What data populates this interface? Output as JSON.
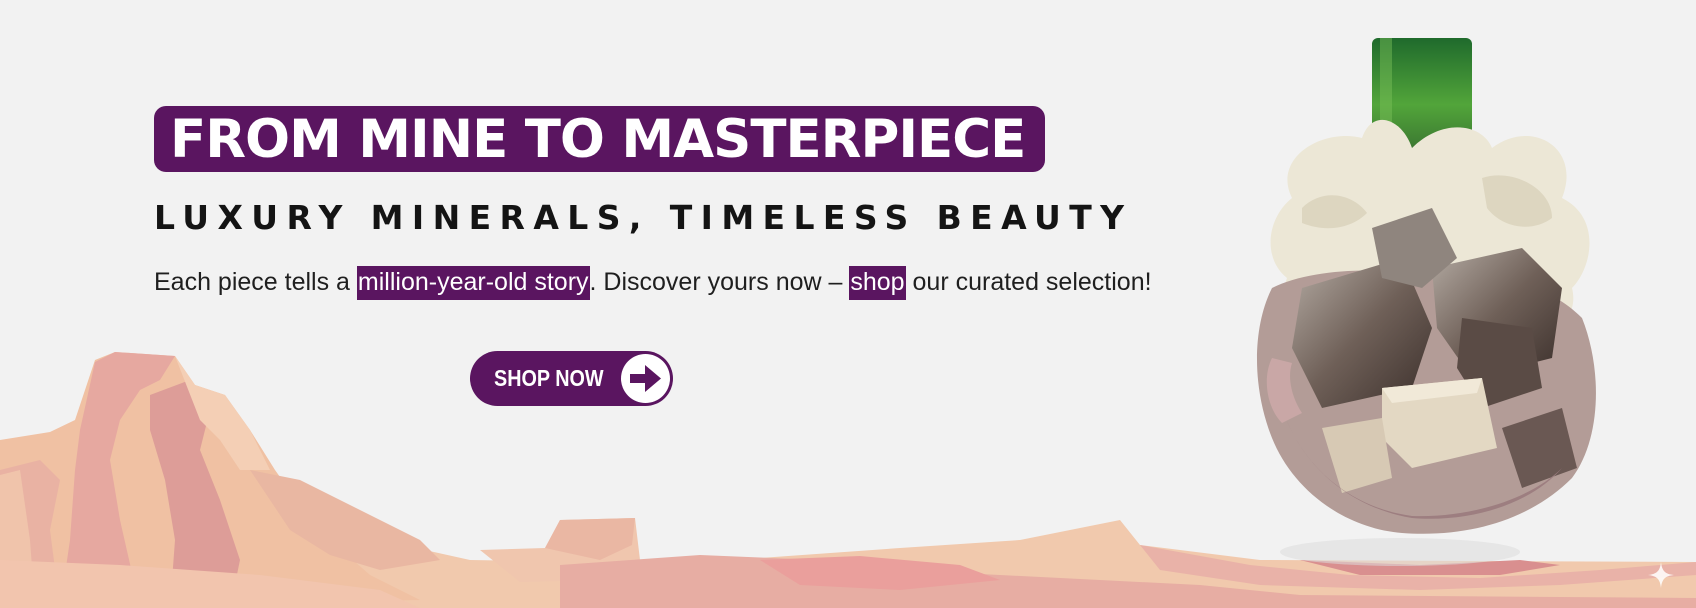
{
  "banner": {
    "headline": "FROM MINE TO MASTERPIECE",
    "subheadline": "LUXURY MINERALS, TIMELESS BEAUTY",
    "body": {
      "part1": "Each piece tells a ",
      "highlight1": "million-year-old story",
      "part2": ". Discover yours now – ",
      "highlight2": "shop",
      "part3": " our curated selection!"
    },
    "cta": {
      "label": "SHOP NOW",
      "icon": "arrow-right-icon"
    },
    "product_image": "tourmaline-cluster-mineral",
    "corner_icon": "sparkle-icon"
  },
  "colors": {
    "brand_purple": "#5a1560",
    "background": "#f2f2f2",
    "text_dark": "#141414",
    "terrain_peach": "#f0c4a8",
    "terrain_pink": "#e3a9a4"
  }
}
